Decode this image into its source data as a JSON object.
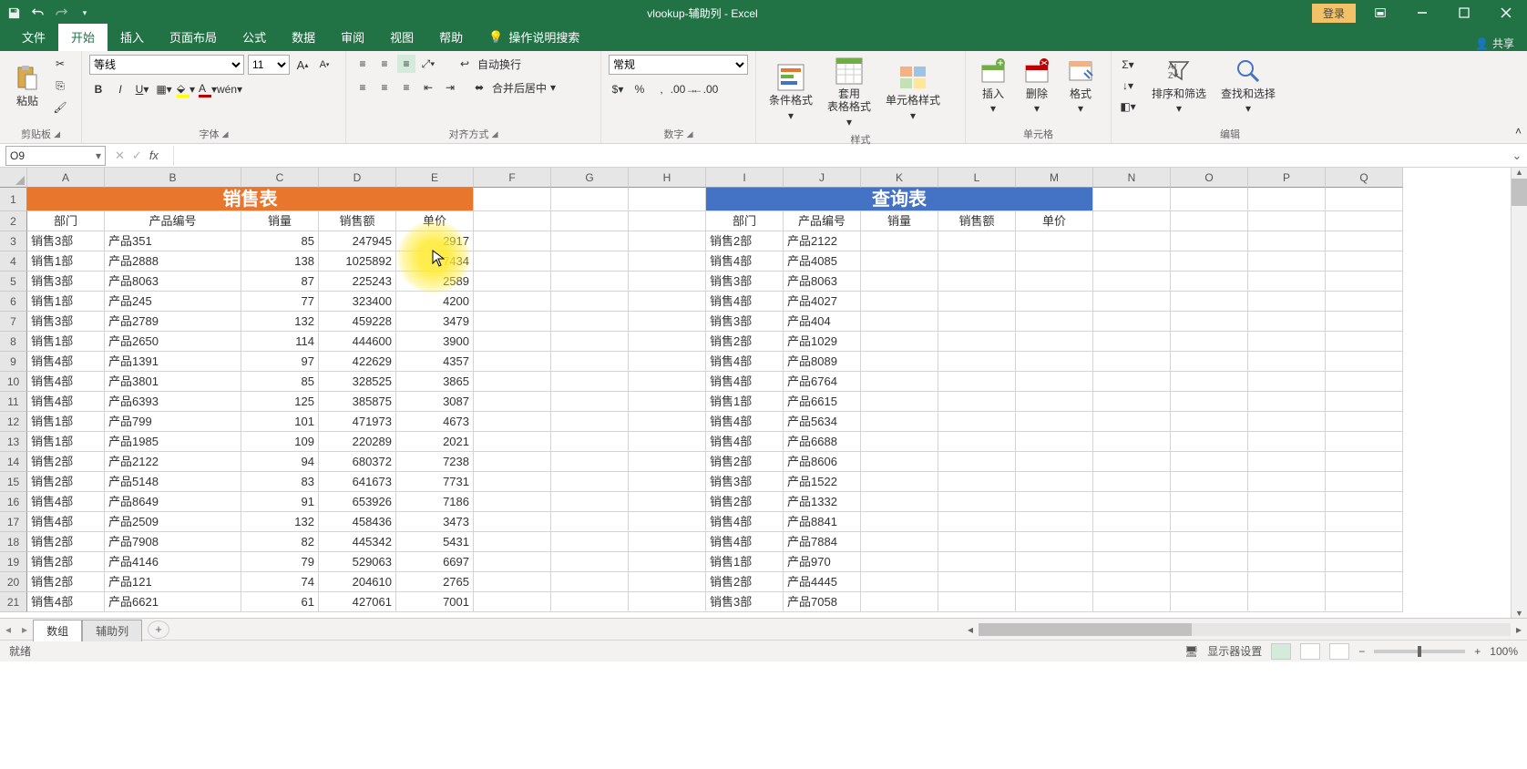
{
  "title": "vlookup-辅助列 - Excel",
  "login": "登录",
  "tabs": {
    "file": "文件",
    "home": "开始",
    "insert": "插入",
    "layout": "页面布局",
    "formulas": "公式",
    "data": "数据",
    "review": "审阅",
    "view": "视图",
    "help": "帮助",
    "tell": "操作说明搜索",
    "share": "共享"
  },
  "ribbon": {
    "clipboard": {
      "paste": "粘贴",
      "name": "剪贴板"
    },
    "font": {
      "family": "等线",
      "size": "11",
      "name": "字体"
    },
    "align": {
      "wrap": "自动换行",
      "merge": "合并后居中",
      "name": "对齐方式"
    },
    "number": {
      "format": "常规",
      "name": "数字"
    },
    "styles": {
      "cond": "条件格式",
      "tblfmt": "套用\n表格格式",
      "cellstyle": "单元格样式",
      "name": "样式"
    },
    "cells": {
      "insert": "插入",
      "delete": "删除",
      "format": "格式",
      "name": "单元格"
    },
    "editing": {
      "sort": "排序和筛选",
      "find": "查找和选择",
      "name": "编辑"
    }
  },
  "namebox": "O9",
  "columns": [
    "A",
    "B",
    "C",
    "D",
    "E",
    "F",
    "G",
    "H",
    "I",
    "J",
    "K",
    "L",
    "M",
    "N",
    "O",
    "P",
    "Q"
  ],
  "mergedHeaders": {
    "sales": "销售表",
    "lookup": "查询表"
  },
  "headers": {
    "dept": "部门",
    "code": "产品编号",
    "qty": "销量",
    "amt": "销售额",
    "price": "单价"
  },
  "sales": [
    {
      "dept": "销售3部",
      "code": "产品351",
      "qty": 85,
      "amt": 247945,
      "price": 2917
    },
    {
      "dept": "销售1部",
      "code": "产品2888",
      "qty": 138,
      "amt": 1025892,
      "price": 7434
    },
    {
      "dept": "销售3部",
      "code": "产品8063",
      "qty": 87,
      "amt": 225243,
      "price": 2589
    },
    {
      "dept": "销售1部",
      "code": "产品245",
      "qty": 77,
      "amt": 323400,
      "price": 4200
    },
    {
      "dept": "销售3部",
      "code": "产品2789",
      "qty": 132,
      "amt": 459228,
      "price": 3479
    },
    {
      "dept": "销售1部",
      "code": "产品2650",
      "qty": 114,
      "amt": 444600,
      "price": 3900
    },
    {
      "dept": "销售4部",
      "code": "产品1391",
      "qty": 97,
      "amt": 422629,
      "price": 4357
    },
    {
      "dept": "销售4部",
      "code": "产品3801",
      "qty": 85,
      "amt": 328525,
      "price": 3865
    },
    {
      "dept": "销售4部",
      "code": "产品6393",
      "qty": 125,
      "amt": 385875,
      "price": 3087
    },
    {
      "dept": "销售1部",
      "code": "产品799",
      "qty": 101,
      "amt": 471973,
      "price": 4673
    },
    {
      "dept": "销售1部",
      "code": "产品1985",
      "qty": 109,
      "amt": 220289,
      "price": 2021
    },
    {
      "dept": "销售2部",
      "code": "产品2122",
      "qty": 94,
      "amt": 680372,
      "price": 7238
    },
    {
      "dept": "销售2部",
      "code": "产品5148",
      "qty": 83,
      "amt": 641673,
      "price": 7731
    },
    {
      "dept": "销售4部",
      "code": "产品8649",
      "qty": 91,
      "amt": 653926,
      "price": 7186
    },
    {
      "dept": "销售4部",
      "code": "产品2509",
      "qty": 132,
      "amt": 458436,
      "price": 3473
    },
    {
      "dept": "销售2部",
      "code": "产品7908",
      "qty": 82,
      "amt": 445342,
      "price": 5431
    },
    {
      "dept": "销售2部",
      "code": "产品4146",
      "qty": 79,
      "amt": 529063,
      "price": 6697
    },
    {
      "dept": "销售2部",
      "code": "产品121",
      "qty": 74,
      "amt": 204610,
      "price": 2765
    },
    {
      "dept": "销售4部",
      "code": "产品6621",
      "qty": 61,
      "amt": 427061,
      "price": 7001
    }
  ],
  "lookup": [
    {
      "dept": "销售2部",
      "code": "产品2122"
    },
    {
      "dept": "销售4部",
      "code": "产品4085"
    },
    {
      "dept": "销售3部",
      "code": "产品8063"
    },
    {
      "dept": "销售4部",
      "code": "产品4027"
    },
    {
      "dept": "销售3部",
      "code": "产品404"
    },
    {
      "dept": "销售2部",
      "code": "产品1029"
    },
    {
      "dept": "销售4部",
      "code": "产品8089"
    },
    {
      "dept": "销售4部",
      "code": "产品6764"
    },
    {
      "dept": "销售1部",
      "code": "产品6615"
    },
    {
      "dept": "销售4部",
      "code": "产品5634"
    },
    {
      "dept": "销售4部",
      "code": "产品6688"
    },
    {
      "dept": "销售2部",
      "code": "产品8606"
    },
    {
      "dept": "销售3部",
      "code": "产品1522"
    },
    {
      "dept": "销售2部",
      "code": "产品1332"
    },
    {
      "dept": "销售4部",
      "code": "产品8841"
    },
    {
      "dept": "销售4部",
      "code": "产品7884"
    },
    {
      "dept": "销售1部",
      "code": "产品970"
    },
    {
      "dept": "销售2部",
      "code": "产品4445"
    },
    {
      "dept": "销售3部",
      "code": "产品7058"
    }
  ],
  "sheets": {
    "active": "数组",
    "other": "辅助列"
  },
  "status": {
    "ready": "就绪",
    "display": "显示器设置",
    "zoom": "100%"
  }
}
